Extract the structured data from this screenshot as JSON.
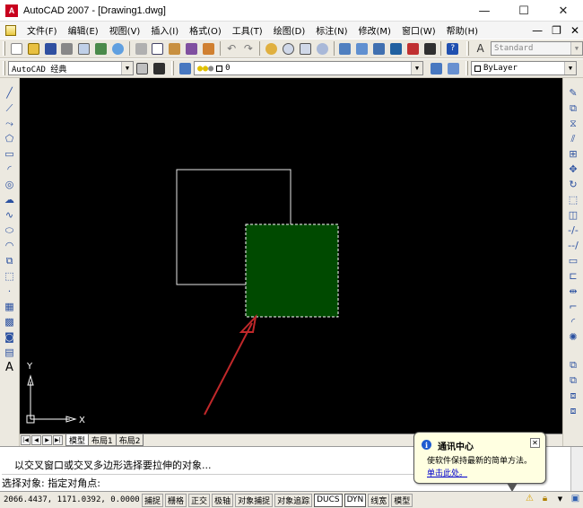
{
  "window": {
    "title": "AutoCAD 2007 - [Drawing1.dwg]",
    "app_icon_letter": "A",
    "minimize": "—",
    "maximize": "☐",
    "close": "✕"
  },
  "menu": {
    "items": [
      "文件(F)",
      "编辑(E)",
      "视图(V)",
      "插入(I)",
      "格式(O)",
      "工具(T)",
      "绘图(D)",
      "标注(N)",
      "修改(M)",
      "窗口(W)",
      "帮助(H)"
    ],
    "doc_controls": [
      "—",
      "❐",
      "✕"
    ]
  },
  "toolbar1": {
    "text_style": "Standard"
  },
  "toolbar2": {
    "workspace": "AutoCAD 经典",
    "layer": "0",
    "color": "ByLayer"
  },
  "tabs": {
    "nav": [
      "|◀",
      "◀",
      "▶",
      "▶|"
    ],
    "items": [
      "模型",
      "布局1",
      "布局2"
    ]
  },
  "ucs": {
    "x": "X",
    "y": "Y"
  },
  "command": {
    "line1": "以交叉窗口或交叉多边形选择要拉伸的对象...",
    "line2": "选择对象: 指定对角点:"
  },
  "balloon": {
    "title": "通讯中心",
    "text": "使软件保持最新的简单方法。",
    "link": "单击此处。",
    "close": "✕",
    "info": "i"
  },
  "status": {
    "coords": "2066.4437, 1171.0392, 0.0000",
    "buttons": [
      "捕捉",
      "栅格",
      "正交",
      "极轴",
      "对象捕捉",
      "对象追踪",
      "DUCS",
      "DYN",
      "线宽",
      "模型"
    ],
    "active": [
      "DUCS",
      "DYN"
    ]
  },
  "colors": {
    "canvas": "#000000",
    "selection_fill": "#004a00",
    "arrow": "#c0282a"
  }
}
